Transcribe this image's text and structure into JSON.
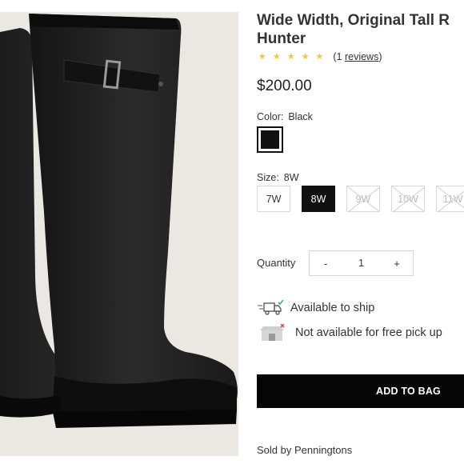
{
  "product": {
    "title_line1": "Wide Width, Original Tall R",
    "title_line2": "Hunter",
    "rating_stars": 5,
    "reviews_count": "(1 ",
    "reviews_link": "reviews",
    "reviews_close": ")",
    "price": "$200.00"
  },
  "color": {
    "label": "Color:",
    "value": "Black",
    "swatch_color": "#111111"
  },
  "size": {
    "label": "Size:",
    "value": "8W",
    "options": [
      {
        "label": "7W",
        "state": "available"
      },
      {
        "label": "8W",
        "state": "selected"
      },
      {
        "label": "9W",
        "state": "unavailable"
      },
      {
        "label": "10W",
        "state": "unavailable"
      },
      {
        "label": "11W",
        "state": "unavailable"
      }
    ]
  },
  "quantity": {
    "label": "Quantity",
    "minus": "-",
    "value": "1",
    "plus": "+"
  },
  "availability": {
    "ship_text": "Available to ship",
    "pickup_text": "Not available for free pick up"
  },
  "actions": {
    "add_to_bag": "ADD TO BAG"
  },
  "seller": {
    "text": "Sold by Penningtons"
  },
  "colors": {
    "star": "#f3c72f",
    "check": "#3cb371",
    "cross": "#e23b3b"
  }
}
